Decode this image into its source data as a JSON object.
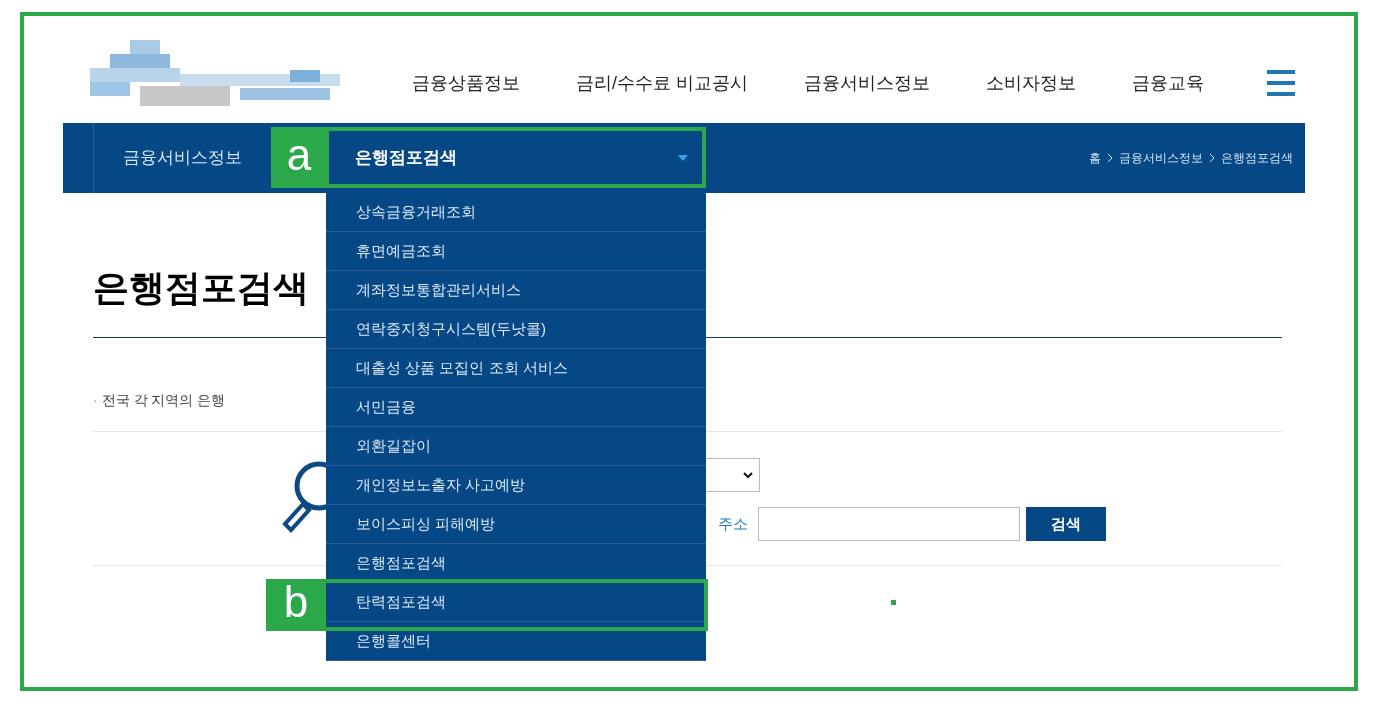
{
  "nav": [
    "금융상품정보",
    "금리/수수료 비교공시",
    "금융서비스정보",
    "소비자정보",
    "금융교육"
  ],
  "subnav": {
    "section": "금융서비스정보",
    "current": "은행점포검색",
    "breadcrumb": [
      "홈",
      "금융서비스정보",
      "은행점포검색"
    ],
    "items": [
      "상속금융거래조회",
      "휴면예금조회",
      "계좌정보통합관리서비스",
      "연락중지청구시스템(두낫콜)",
      "대출성 상품 모집인 조회 서비스",
      "서민금융",
      "외환길잡이",
      "개인정보노출자 사고예방",
      "보이스피싱 피해예방",
      "은행점포검색",
      "탄력점포검색",
      "은행콜센터"
    ]
  },
  "page": {
    "title": "은행점포검색",
    "bullet": "·",
    "note": "전국 각 지역의 은행",
    "address_label": "주소",
    "search_button": "검색"
  },
  "annotations": [
    {
      "label": "a"
    },
    {
      "label": "b"
    }
  ]
}
